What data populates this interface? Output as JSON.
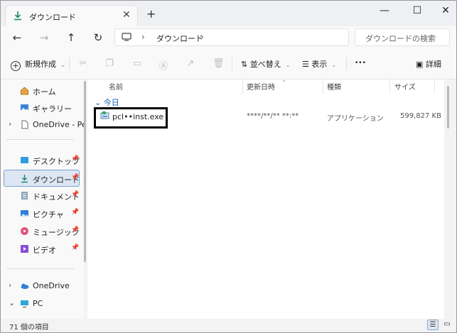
{
  "tab": {
    "title": "ダウンロード",
    "close": "✕",
    "new": "+"
  },
  "window_controls": {
    "minimize": "—",
    "maximize": "☐",
    "close": "✕"
  },
  "nav_buttons": {
    "back": "←",
    "forward": "→",
    "up": "↑",
    "refresh": "↻"
  },
  "address": {
    "separator": "›",
    "crumb": "ダウンロード"
  },
  "search": {
    "placeholder": "ダウンロードの検索"
  },
  "commands": {
    "new_label": "新規作成",
    "sort_label": "並べ替え",
    "view_label": "表示",
    "more": "•••",
    "details_label": "詳細"
  },
  "sidebar": {
    "items": [
      {
        "label": "ホーム",
        "icon": "home-icon"
      },
      {
        "label": "ギャラリー",
        "icon": "gallery-icon"
      },
      {
        "label": "OneDrive - Perso",
        "icon": "document-icon"
      },
      {
        "label": "デスクトップ",
        "icon": "desktop-icon"
      },
      {
        "label": "ダウンロード",
        "icon": "download-icon"
      },
      {
        "label": "ドキュメント",
        "icon": "documents-icon"
      },
      {
        "label": "ピクチャ",
        "icon": "pictures-icon"
      },
      {
        "label": "ミュージック",
        "icon": "music-icon"
      },
      {
        "label": "ビデオ",
        "icon": "video-icon"
      },
      {
        "label": "OneDrive",
        "icon": "cloud-icon"
      },
      {
        "label": "PC",
        "icon": "pc-icon"
      }
    ]
  },
  "columns": {
    "name": "名前",
    "modified": "更新日時",
    "type": "種類",
    "size": "サイズ"
  },
  "group": {
    "label": "今日"
  },
  "files": [
    {
      "name": "pcl••inst.exe",
      "modified": "****/**/** **:**",
      "type": "アプリケーション",
      "size": "599,827 KB"
    }
  ],
  "status": {
    "count": "71 個の項目"
  },
  "colors": {
    "accent": "#1a5fb4",
    "selected_bg": "#dde6f3",
    "highlight_border": "#000000"
  }
}
